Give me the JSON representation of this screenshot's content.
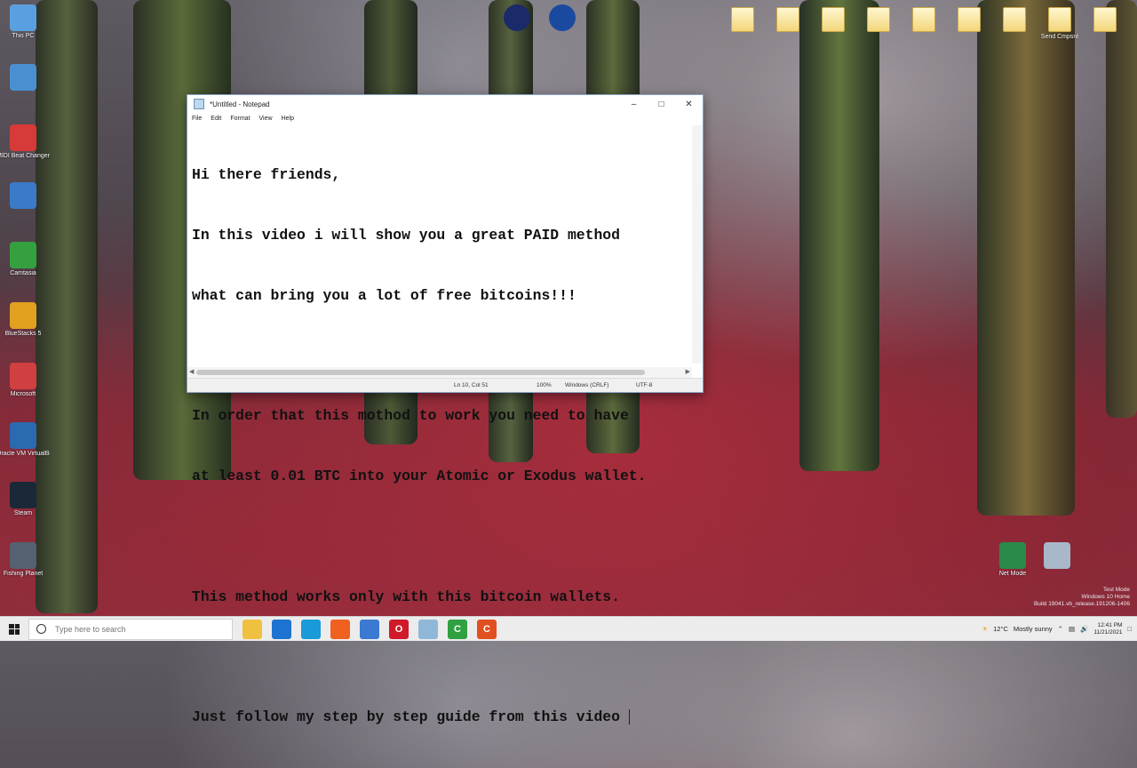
{
  "desktop": {
    "left_icons": [
      {
        "label": "This PC",
        "color": "#5aa0e0"
      },
      {
        "label": "",
        "color": "#4a90d0"
      },
      {
        "label": "MIDI Beat Changer",
        "color": "#d83a3a"
      },
      {
        "label": "",
        "color": "#3a7ac8"
      },
      {
        "label": "Camtasia",
        "color": "#35a040"
      },
      {
        "label": "BlueStacks 5",
        "color": "#e0a020"
      },
      {
        "label": "Microsoft",
        "color": "#d04040"
      },
      {
        "label": "Oracle VM VirtualBox",
        "color": "#2a6ab0"
      },
      {
        "label": "Steam",
        "color": "#1b2838"
      },
      {
        "label": "Fishing Planet",
        "color": "#556070"
      }
    ],
    "top_icons": [
      {
        "label": "",
        "color": "#1a2a6a"
      },
      {
        "label": "",
        "color": "#1a4aa0"
      }
    ],
    "folders": [
      "",
      "",
      "",
      "",
      "",
      "",
      "",
      "Send Cmpsnt",
      ""
    ],
    "recycle_icons": [
      {
        "label": "Net Mode",
        "color": "#2a8a4a"
      },
      {
        "label": "",
        "color": "#a8b8c8"
      }
    ]
  },
  "notepad": {
    "title": "*Untitled - Notepad",
    "menu": [
      "File",
      "Edit",
      "Format",
      "View",
      "Help"
    ],
    "lines": [
      "Hi there friends,",
      "In this video i will show you a great PAID method",
      "what can bring you a lot of free bitcoins!!!",
      "",
      "In order that this mothod to work you need to have",
      "at least 0.01 BTC into your Atomic or Exodus wallet.",
      "",
      "This method works only with this bitcoin wallets.",
      "",
      "Just follow my step by step guide from this video "
    ],
    "status": {
      "position": "Ln 10, Col 51",
      "zoom": "100%",
      "line_ending": "Windows (CRLF)",
      "encoding": "UTF-8"
    }
  },
  "taskbar": {
    "search_placeholder": "Type here to search",
    "apps": [
      {
        "name": "file-explorer",
        "color": "#f0c040",
        "glyph": ""
      },
      {
        "name": "browser-blue",
        "color": "#1e73d0",
        "glyph": ""
      },
      {
        "name": "edge",
        "color": "#1a9ad8",
        "glyph": ""
      },
      {
        "name": "firefox",
        "color": "#f06020",
        "glyph": ""
      },
      {
        "name": "store",
        "color": "#3a7ad0",
        "glyph": ""
      },
      {
        "name": "opera",
        "color": "#d01a2a",
        "glyph": "O"
      },
      {
        "name": "notepad",
        "color": "#8fb8d8",
        "glyph": ""
      },
      {
        "name": "camtasia",
        "color": "#30a040",
        "glyph": "C"
      },
      {
        "name": "recorder",
        "color": "#e05020",
        "glyph": "C"
      }
    ],
    "tray": {
      "temperature": "12°C",
      "weather": "Mostly sunny",
      "time": "12:41 PM",
      "date": "11/21/2021"
    }
  },
  "watermark": {
    "line1": "Test Mode",
    "line2": "Windows 10 Home",
    "line3": "Build 19041.vb_release.191206-1406"
  }
}
